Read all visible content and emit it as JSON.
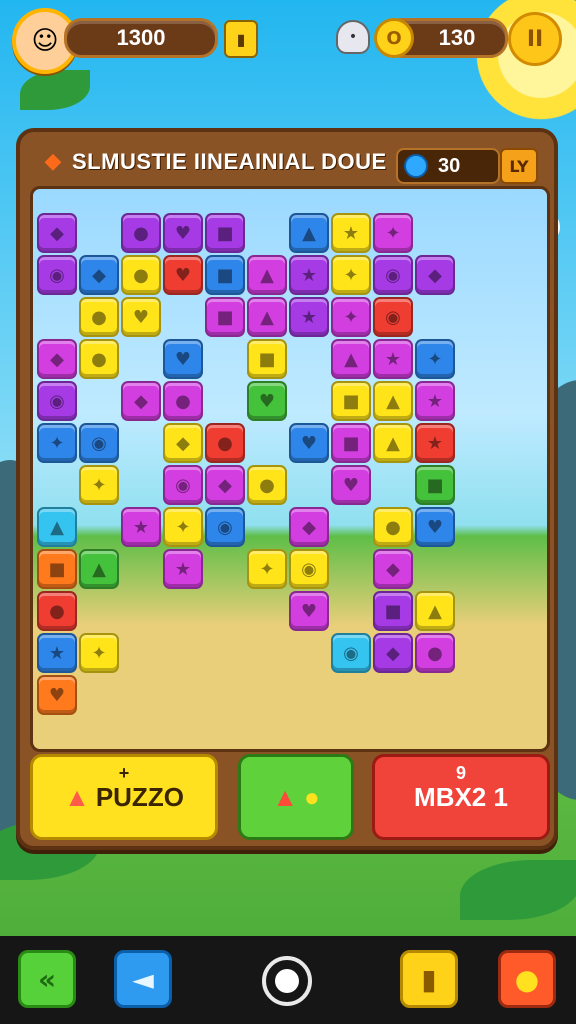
{
  "top_bar": {
    "score": "1300",
    "coins": "130",
    "icons": [
      "avatar",
      "card-icon",
      "ghost-icon",
      "coin-icon",
      "pause-icon"
    ]
  },
  "panel": {
    "title": "SLMUSTIE IINEAINIAL DOUE",
    "gems": "30",
    "box_label": "LY"
  },
  "actions": [
    {
      "label": "PUZZO",
      "top": "+",
      "icon": "mushroom-icon",
      "color": "#ffe11f"
    },
    {
      "label": "",
      "top": "",
      "icon": "mushroom-banana-icon",
      "color": "#5fd13a"
    },
    {
      "label": "MBX2 1",
      "top": "9",
      "icon": "",
      "color": "#f0443a"
    }
  ],
  "nav": [
    "back-icon",
    "sound-icon",
    "home-button",
    "card-icon",
    "hint-icon"
  ],
  "colors": {
    "purple": "#a63be6",
    "magenta": "#d33ee0",
    "yellow": "#ffe41a",
    "blue": "#2f86ea",
    "teal": "#35c3f0",
    "red": "#ef3d32",
    "green": "#45c23c",
    "orange": "#ff7a1c"
  }
}
